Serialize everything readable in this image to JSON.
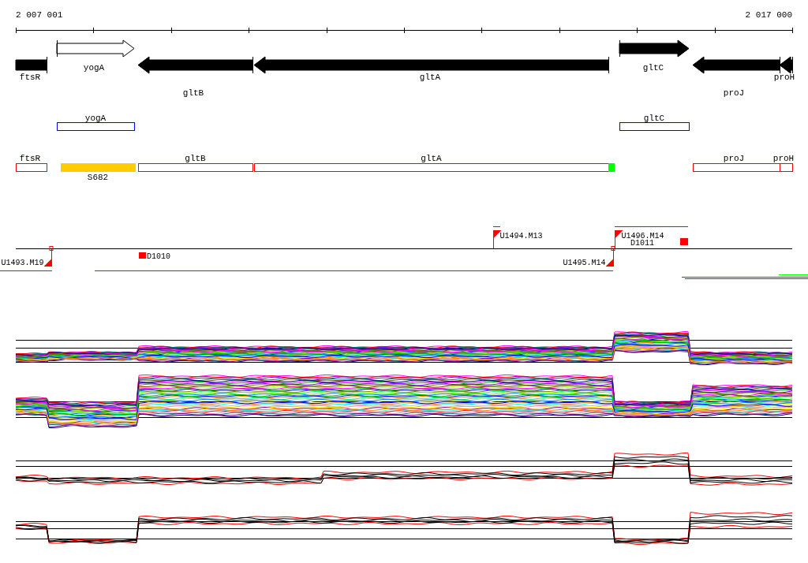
{
  "scale": {
    "start": "2 007 001",
    "end": "2 017 000"
  },
  "gene_track": [
    {
      "label": "ftsR",
      "kind": "reverse",
      "outlined": false
    },
    {
      "label": "yogA",
      "kind": "forward",
      "outlined": true
    },
    {
      "label": "gltB",
      "kind": "reverse",
      "outlined": false
    },
    {
      "label": "gltA",
      "kind": "reverse",
      "outlined": false
    },
    {
      "label": "gltC",
      "kind": "forward",
      "outlined": false
    },
    {
      "label": "proJ",
      "kind": "reverse",
      "outlined": false
    },
    {
      "label": "proH",
      "kind": "reverse",
      "outlined": false
    }
  ],
  "cds_track": [
    {
      "label": "yogA"
    },
    {
      "label": "gltC"
    }
  ],
  "region_track": [
    {
      "label": "ftsR",
      "kind": "outline",
      "color": "#ff0000"
    },
    {
      "label": "S682",
      "kind": "filled",
      "color": "#ffcc00"
    },
    {
      "label": "gltB",
      "kind": "outline",
      "color": "#ff0000"
    },
    {
      "label": "gltA",
      "kind": "outline",
      "color": "#ff0000"
    },
    {
      "kind": "filled",
      "color": "#00ff00"
    },
    {
      "label": "proJ",
      "kind": "outline",
      "color": "#ff0000"
    },
    {
      "label": "proH",
      "kind": "outline",
      "color": "#ff0000"
    }
  ],
  "markers": [
    {
      "label": "U1493.M19",
      "kind": "downflag"
    },
    {
      "label": "D1010",
      "kind": "square"
    },
    {
      "label": "U1494.M13",
      "kind": "upflag"
    },
    {
      "label": "U1496.M14",
      "kind": "upflag"
    },
    {
      "label": "D1011",
      "kind": "square"
    },
    {
      "label": "U1495.M14",
      "kind": "downflag"
    }
  ]
}
